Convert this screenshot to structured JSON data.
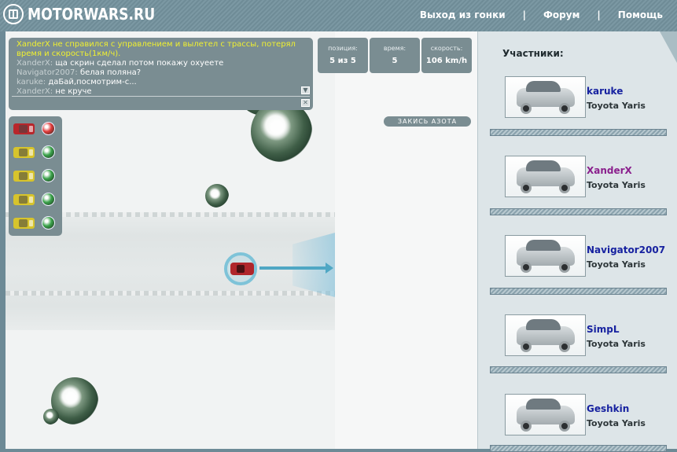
{
  "header": {
    "logo_text": "MOTORWARS.RU",
    "nav": [
      {
        "label": "Выход из гонки"
      },
      {
        "label": "Форум"
      },
      {
        "label": "Помощь"
      }
    ],
    "separator": "|"
  },
  "chat": {
    "system_message": "XanderX не справился с управлением и вылетел с трассы, потерял время и скорость(1км/ч).",
    "messages": [
      {
        "nick": "XanderX:",
        "text": "ща скрин сделал потом покажу охуеете"
      },
      {
        "nick": "Navigator2007:",
        "text": "белая поляна?"
      },
      {
        "nick": "karuke:",
        "text": "даБай,посмотрим-с..."
      },
      {
        "nick": "XanderX:",
        "text": "не круче"
      }
    ],
    "scroll_down_glyph": "▼",
    "close_glyph": "✕"
  },
  "stats": {
    "position": {
      "label": "позиция:",
      "value": "5 из 5"
    },
    "time": {
      "label": "время:",
      "value": "5"
    },
    "speed": {
      "label": "скорость:",
      "value": "106 km/h"
    }
  },
  "nitro_button": "ЗАКИСЬ АЗОТА",
  "lights": [
    {
      "car_color": "#b8262b",
      "light": "red",
      "light_color": "#e23a3a"
    },
    {
      "car_color": "#d7c42c",
      "light": "green",
      "light_color": "#3aa34a"
    },
    {
      "car_color": "#d7c42c",
      "light": "green",
      "light_color": "#3aa34a"
    },
    {
      "car_color": "#d7c42c",
      "light": "green",
      "light_color": "#3aa34a"
    },
    {
      "car_color": "#d7c42c",
      "light": "green",
      "light_color": "#3aa34a"
    }
  ],
  "sidebar": {
    "title": "Участники:",
    "players": [
      {
        "name": "karuke",
        "car": "Toyota Yaris",
        "name_color": "#1722a0"
      },
      {
        "name": "XanderX",
        "car": "Toyota Yaris",
        "name_color": "#8a1f8c"
      },
      {
        "name": "Navigator2007",
        "car": "Toyota Yaris",
        "name_color": "#1722a0"
      },
      {
        "name": "SimpL",
        "car": "Toyota Yaris",
        "name_color": "#1722a0"
      },
      {
        "name": "Geshkin",
        "car": "Toyota Yaris",
        "name_color": "#1722a0"
      }
    ]
  }
}
